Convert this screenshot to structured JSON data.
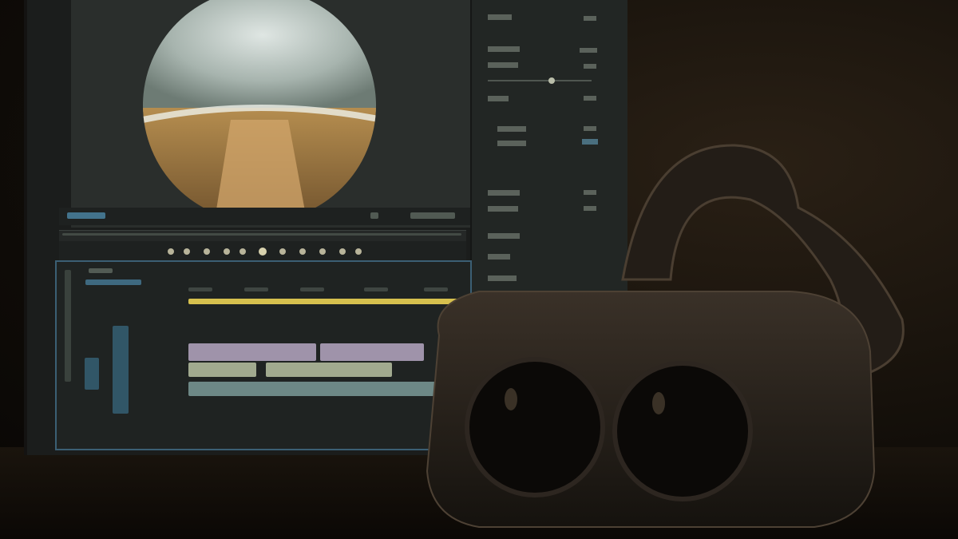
{
  "scene": {
    "description_visible_text": [],
    "colors": {
      "accent_timeline_border": "#3b5f74",
      "audio_clip": "#b6a7c2",
      "video_clip": "#b9c2a2",
      "marker_bar": "#d6c04e",
      "headset": "#1a1714"
    }
  },
  "elements": {
    "monitor_icon": "monitor-icon",
    "headset_icon": "vr-headset-icon"
  }
}
